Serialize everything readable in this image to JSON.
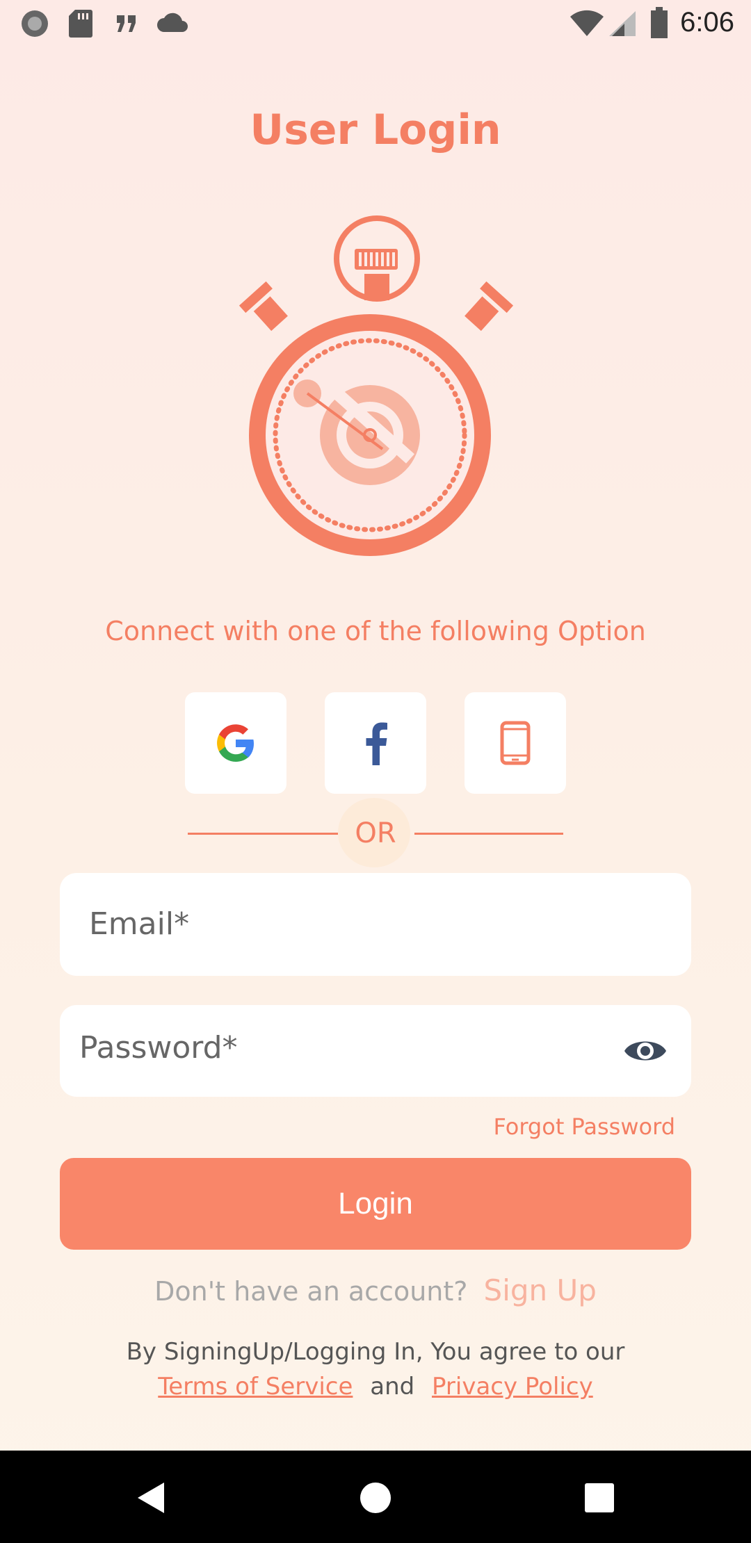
{
  "status_bar": {
    "time": "6:06",
    "left_icons": [
      "record-icon",
      "sd-card-icon",
      "quote-icon",
      "cloud-icon"
    ],
    "right_icons": [
      "wifi-icon",
      "signal-icon",
      "battery-icon"
    ]
  },
  "header": {
    "title": "User Login"
  },
  "connect": {
    "subtitle": "Connect with one of the following Option"
  },
  "social": {
    "google_icon": "google-g-icon",
    "facebook_icon": "facebook-f-icon",
    "phone_icon": "smartphone-icon"
  },
  "divider": {
    "text": "OR"
  },
  "form": {
    "email_placeholder": "Email*",
    "password_placeholder": "Password*",
    "forgot_label": "Forgot Password",
    "login_label": "Login"
  },
  "signup": {
    "question": "Don't have an account?",
    "link": "Sign Up"
  },
  "legal": {
    "line1": "By SigningUp/Logging In, You agree to our",
    "terms": "Terms of Service",
    "and": "and",
    "privacy": "Privacy Policy"
  },
  "colors": {
    "accent": "#f47f63",
    "button": "#f98669",
    "background": "#fdeee6",
    "nav_bar": "#000000"
  }
}
